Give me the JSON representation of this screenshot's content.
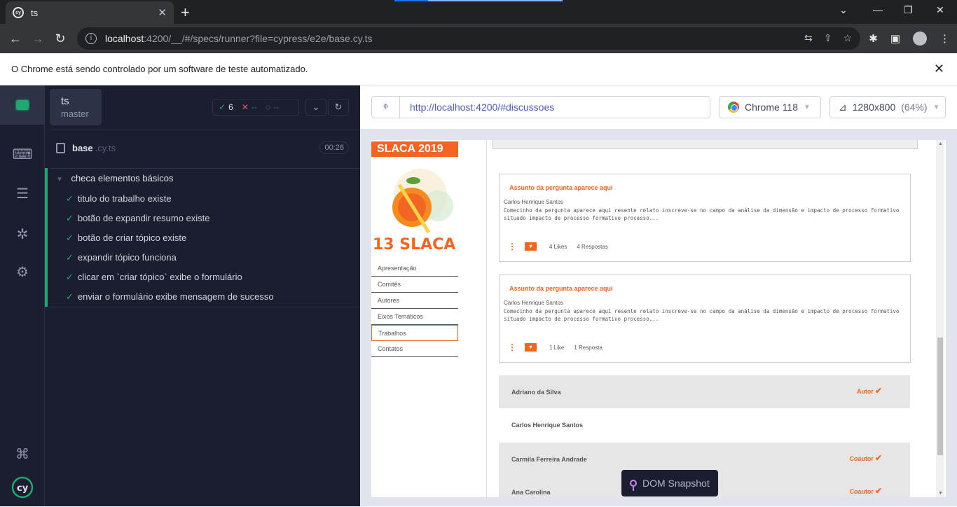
{
  "browser": {
    "tab_title": "ts",
    "tab_favicon": "cy",
    "address_host": "localhost",
    "address_rest": ":4200/__/#/specs/runner?file=cypress/e2e/base.cy.ts",
    "infobar_text": "O Chrome está sendo controlado por um software de teste automatizado."
  },
  "cypress": {
    "project_name": "ts",
    "branch": "master",
    "passed_count": "6",
    "failed_count": "--",
    "pending_count": "--",
    "spec_name": "base",
    "spec_ext": ".cy.ts",
    "duration": "00:26",
    "suite_title": "checa elementos básicos",
    "tests": [
      "titulo do trabalho existe",
      "botão de expandir resumo existe",
      "botão de criar tópico existe",
      "expandir tópico funciona",
      "clicar em `criar tópico` exibe o formulário",
      "enviar o formulário exibe mensagem de sucesso"
    ],
    "aut_url": "http://localhost:4200/#discussoes",
    "browser_name": "Chrome 118",
    "viewport_size": "1280x800",
    "viewport_scale": "(64%)",
    "snapshot_label": "DOM Snapshot"
  },
  "site": {
    "header": "SLACA 2019",
    "logo_text": "13 SLACA",
    "menu": [
      "Apresentação",
      "Comitês",
      "Autores",
      "Eixos Temáticos",
      "Trabalhos",
      "Contatos"
    ],
    "cards": [
      {
        "subject": "Assunto da pergunta aparece aqui",
        "author": "Carlos Henrique Santos",
        "body": "Comecinho da pergunta aparece aqui resente relato inscreve-se no campo da análise da dimensão e impacto de processo formativo situado impacto de processo formativo processo...",
        "likes": "4 Likes",
        "answers": "4 Respostas"
      },
      {
        "subject": "Assunto da pergunta aparece aqui",
        "author": "Carlos Henrique Santos",
        "body": "Comecinho da pergunta aparece aqui resente relato inscreve-se no campo da análise da dimensão e impacto de processo formativo situado impacto de processo formativo processo...",
        "likes": "1 Like",
        "answers": "1 Resposta"
      }
    ],
    "people": [
      {
        "name": "Adriano da Silva",
        "role": "Autor"
      },
      {
        "name": "Carlos Henrique Santos",
        "role": ""
      },
      {
        "name": "Carmila Ferreira Andrade",
        "role": "Coautor"
      },
      {
        "name": "Ana Carolina",
        "role": "Coautor"
      }
    ]
  },
  "colors": {
    "accent": "#f26522",
    "cypress_pass": "#1fa971",
    "cypress_bg": "#1b1e2e"
  }
}
